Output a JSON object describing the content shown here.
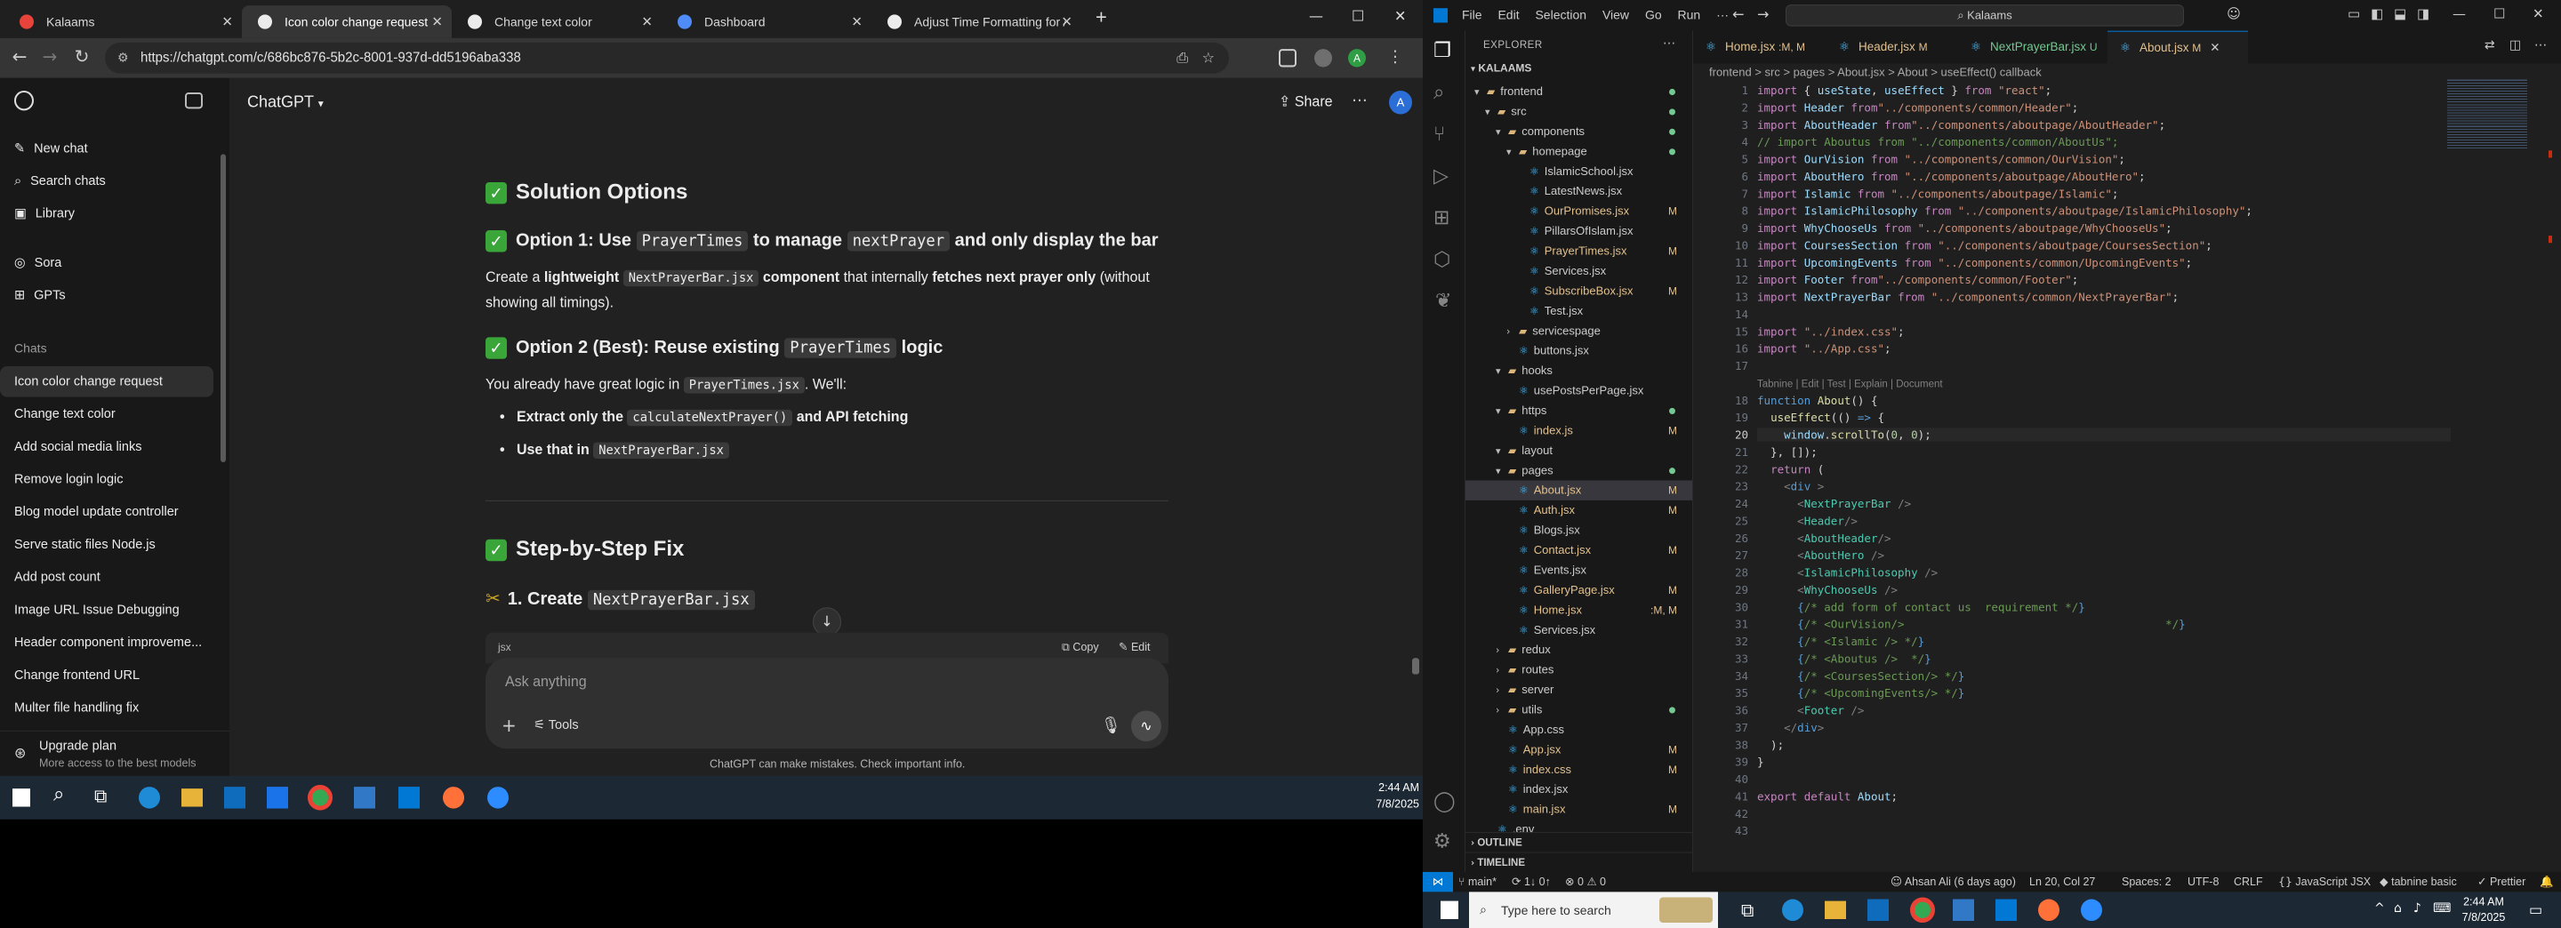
{
  "chrome": {
    "tabs": [
      {
        "label": "Kalaams",
        "color": "#e8433a"
      },
      {
        "label": "Icon color change request",
        "color": "#ffffff"
      },
      {
        "label": "Change text color",
        "color": "#ffffff"
      },
      {
        "label": "Dashboard",
        "color": "#4f8cf7"
      },
      {
        "label": "Adjust Time Formatting for AM/",
        "color": "#ffffff"
      }
    ],
    "new_tab": "+",
    "url": "https://chatgpt.com/c/686bc876-5b2c-8001-937d-dd5196aba338",
    "window_controls": [
      "—",
      "☐",
      "✕"
    ]
  },
  "chatgpt": {
    "model": "ChatGPT",
    "share": "Share",
    "sidebar": {
      "new_chat": "New chat",
      "search": "Search chats",
      "library": "Library",
      "sora": "Sora",
      "gpts": "GPTs",
      "chats_header": "Chats",
      "chats": [
        "Icon color change request",
        "Change text color",
        "Add social media links",
        "Remove login logic",
        "Blog model update controller",
        "Serve static files Node.js",
        "Add post count",
        "Image URL Issue Debugging",
        "Header component improveme...",
        "Change frontend URL",
        "Multer file handling fix"
      ],
      "upgrade_title": "Upgrade plan",
      "upgrade_sub": "More access to the best models"
    },
    "content": {
      "h_solution": "Solution Options",
      "opt1_prefix": "Option 1: Use",
      "opt1_code1": "PrayerTimes",
      "opt1_mid": "to manage",
      "opt1_code2": "nextPrayer",
      "opt1_suffix": "and only display the bar",
      "opt1_p_a": "Create a",
      "opt1_p_b": "lightweight",
      "opt1_p_code": "NextPrayerBar.jsx",
      "opt1_p_c": "component",
      "opt1_p_d": "that internally",
      "opt1_p_e": "fetches next prayer only",
      "opt1_p_f": "(without",
      "opt1_p_line2": "showing all timings).",
      "opt2_prefix": "Option 2 (Best): Reuse existing",
      "opt2_code": "PrayerTimes",
      "opt2_suffix": "logic",
      "opt2_p_a": "You already have great logic in",
      "opt2_p_code": "PrayerTimes.jsx",
      "opt2_p_b": ". We'll:",
      "bullet1_a": "Extract only the",
      "bullet1_code": "calculateNextPrayer()",
      "bullet1_b": "and API fetching",
      "bullet2_a": "Use that in",
      "bullet2_code": "NextPrayerBar.jsx",
      "h_step": "Step-by-Step Fix",
      "step1_prefix": "1. Create",
      "step1_code": "NextPrayerBar.jsx",
      "code_lang": "jsx",
      "copy": "Copy",
      "edit": "Edit"
    },
    "composer": {
      "placeholder": "Ask anything",
      "tools": "Tools"
    },
    "disclaimer": "ChatGPT can make mistakes. Check important info."
  },
  "taskbar_left": {
    "time": "2:44 AM",
    "date": "7/8/2025"
  },
  "vscode": {
    "menu": [
      "File",
      "Edit",
      "Selection",
      "View",
      "Go",
      "Run",
      "···"
    ],
    "search": "Kalaams",
    "explorer_title": "EXPLORER",
    "root": "KALAAMS",
    "tree": [
      {
        "label": "frontend",
        "depth": 0,
        "kind": "open",
        "badge": "dot"
      },
      {
        "label": "src",
        "depth": 1,
        "kind": "open",
        "badge": "dot"
      },
      {
        "label": "components",
        "depth": 2,
        "kind": "open",
        "badge": "dot"
      },
      {
        "label": "homepage",
        "depth": 3,
        "kind": "open",
        "badge": "dot"
      },
      {
        "label": "IslamicSchool.jsx",
        "depth": 4,
        "kind": "file",
        "badge": ""
      },
      {
        "label": "LatestNews.jsx",
        "depth": 4,
        "kind": "file",
        "badge": ""
      },
      {
        "label": "OurPromises.jsx",
        "depth": 4,
        "kind": "file",
        "badge": "M"
      },
      {
        "label": "PillarsOfIslam.jsx",
        "depth": 4,
        "kind": "file",
        "badge": ""
      },
      {
        "label": "PrayerTimes.jsx",
        "depth": 4,
        "kind": "file",
        "badge": "M"
      },
      {
        "label": "Services.jsx",
        "depth": 4,
        "kind": "file",
        "badge": ""
      },
      {
        "label": "SubscribeBox.jsx",
        "depth": 4,
        "kind": "file",
        "badge": "M"
      },
      {
        "label": "Test.jsx",
        "depth": 4,
        "kind": "file",
        "badge": ""
      },
      {
        "label": "servicespage",
        "depth": 3,
        "kind": "closed",
        "badge": ""
      },
      {
        "label": "buttons.jsx",
        "depth": 3,
        "kind": "file",
        "badge": ""
      },
      {
        "label": "hooks",
        "depth": 2,
        "kind": "open",
        "badge": ""
      },
      {
        "label": "usePostsPerPage.jsx",
        "depth": 3,
        "kind": "file",
        "badge": ""
      },
      {
        "label": "https",
        "depth": 2,
        "kind": "open",
        "badge": "dot"
      },
      {
        "label": "index.js",
        "depth": 3,
        "kind": "file",
        "badge": "M"
      },
      {
        "label": "layout",
        "depth": 2,
        "kind": "open",
        "badge": ""
      },
      {
        "label": "pages",
        "depth": 2,
        "kind": "open",
        "badge": "dot"
      },
      {
        "label": "About.jsx",
        "depth": 3,
        "kind": "file",
        "badge": "M",
        "selected": true
      },
      {
        "label": "Auth.jsx",
        "depth": 3,
        "kind": "file",
        "badge": "M"
      },
      {
        "label": "Blogs.jsx",
        "depth": 3,
        "kind": "file",
        "badge": ""
      },
      {
        "label": "Contact.jsx",
        "depth": 3,
        "kind": "file",
        "badge": "M"
      },
      {
        "label": "Events.jsx",
        "depth": 3,
        "kind": "file",
        "badge": ""
      },
      {
        "label": "GalleryPage.jsx",
        "depth": 3,
        "kind": "file",
        "badge": "M"
      },
      {
        "label": "Home.jsx",
        "depth": 3,
        "kind": "file",
        "badge": ":M, M"
      },
      {
        "label": "Services.jsx",
        "depth": 3,
        "kind": "file",
        "badge": ""
      },
      {
        "label": "redux",
        "depth": 2,
        "kind": "closed",
        "badge": ""
      },
      {
        "label": "routes",
        "depth": 2,
        "kind": "closed",
        "badge": ""
      },
      {
        "label": "server",
        "depth": 2,
        "kind": "closed",
        "badge": ""
      },
      {
        "label": "utils",
        "depth": 2,
        "kind": "closed",
        "badge": "dot"
      },
      {
        "label": "App.css",
        "depth": 2,
        "kind": "file",
        "badge": ""
      },
      {
        "label": "App.jsx",
        "depth": 2,
        "kind": "file",
        "badge": "M"
      },
      {
        "label": "index.css",
        "depth": 2,
        "kind": "file",
        "badge": "M"
      },
      {
        "label": "index.jsx",
        "depth": 2,
        "kind": "file",
        "badge": ""
      },
      {
        "label": "main.jsx",
        "depth": 2,
        "kind": "file",
        "badge": "M"
      },
      {
        "label": ".env",
        "depth": 1,
        "kind": "file",
        "badge": ""
      }
    ],
    "outline": "OUTLINE",
    "timeline": "TIMELINE",
    "tabs": [
      {
        "label": "Home.jsx",
        "badge": ":M, M"
      },
      {
        "label": "Header.jsx",
        "badge": "M"
      },
      {
        "label": "NextPrayerBar.jsx",
        "badge": "U"
      },
      {
        "label": "About.jsx",
        "badge": "M"
      }
    ],
    "breadcrumb": "frontend > src > pages > About.jsx > About > useEffect() callback",
    "codelens": "Tabnine | Edit | Test | Explain | Document",
    "status": {
      "branch": "main*",
      "sync": "1↓ 0↑",
      "problems": "⊗ 0 ⚠ 0",
      "blame": "Ahsan Ali (6 days ago)",
      "position": "Ln 20, Col 27",
      "spaces": "Spaces: 2",
      "encoding": "UTF-8",
      "eol": "CRLF",
      "language": "JavaScript JSX",
      "tabnine": "tabnine basic",
      "prettier": "✓ Prettier"
    },
    "taskbar_search": "Type here to search",
    "time": "2:44 AM",
    "date": "7/8/2025"
  }
}
